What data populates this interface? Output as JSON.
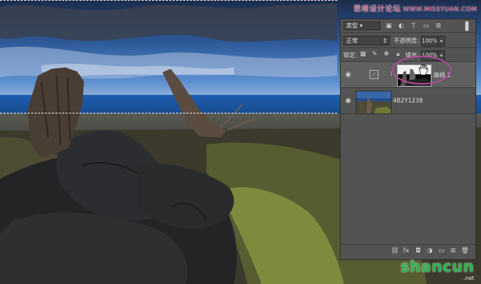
{
  "watermark_top": {
    "text": "思缘设计论坛",
    "url": "WWW.MISSYUAN.COM"
  },
  "watermark_bottom": {
    "brand": "shancun",
    "sub": ".net"
  },
  "layers_panel": {
    "filter_kind": "类型",
    "blend_mode": "正常",
    "opacity_label": "不透明度:",
    "opacity_value": "100%",
    "lock_label": "锁定:",
    "fill_label": "填充:",
    "fill_value": "100%",
    "layers": [
      {
        "name": "曲线 1",
        "type": "adjustment",
        "selected": true
      },
      {
        "name": "4B2Y1238",
        "type": "photo",
        "selected": false
      }
    ]
  }
}
